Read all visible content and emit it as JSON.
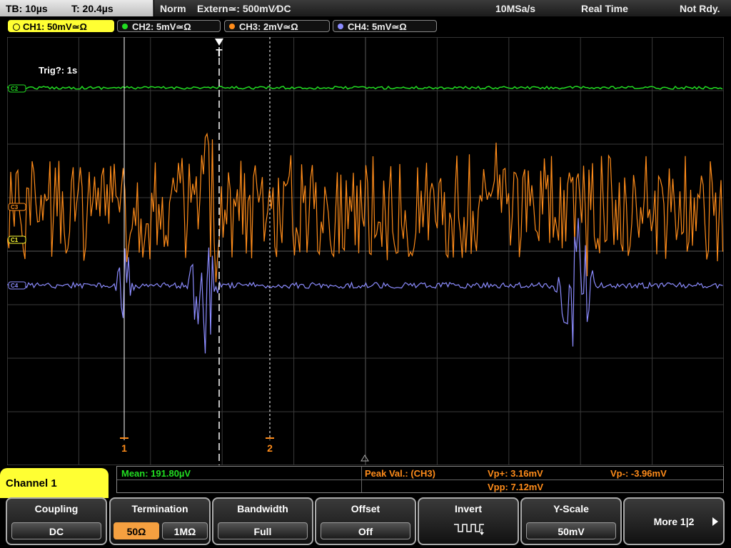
{
  "timebase": {
    "tb": "TB: 10µs",
    "t": "T: 20.4µs"
  },
  "status": {
    "mode": "Norm",
    "trigger": "Extern≃: 500mV∕DC",
    "sample_rate": "10MSa/s",
    "acq": "Real Time",
    "state": "Not Rdy."
  },
  "channels": [
    {
      "label": "CH1: 50mV≃Ω",
      "color": "#ffff33",
      "active": true
    },
    {
      "label": "CH2: 5mV≃Ω",
      "color": "#22dd22",
      "active": false
    },
    {
      "label": "CH3: 2mV≃Ω",
      "color": "#ff8c1a",
      "active": false
    },
    {
      "label": "CH4: 5mV≃Ω",
      "color": "#8c8cff",
      "active": false
    }
  ],
  "trig_label": "Trig?: 1s",
  "trigger_marker": "T",
  "cursors": {
    "c1": "1",
    "c2": "2"
  },
  "markers": {
    "ch2": "C2",
    "ch3": "C3",
    "ch1": "C1",
    "ch4": "C4"
  },
  "colors": {
    "ch1": "#ffff33",
    "ch2": "#22dd22",
    "ch3": "#ff8c1a",
    "ch4": "#8c8cff",
    "meas_green": "#22dd22",
    "meas_orange": "#ff8c1a"
  },
  "measure": {
    "mean": "Mean: 191.80µV",
    "peak_label": "Peak Val.: (CH3)",
    "vp_plus": "Vp+: 3.16mV",
    "vp_minus": "Vp-: -3.96mV",
    "vpp": "Vpp: 7.12mV"
  },
  "channel_title": "Channel 1",
  "softkeys": {
    "coupling": {
      "title": "Coupling",
      "value": "DC"
    },
    "termination": {
      "title": "Termination",
      "opt1": "50Ω",
      "opt2": "1MΩ"
    },
    "bandwidth": {
      "title": "Bandwidth",
      "value": "Full"
    },
    "offset": {
      "title": "Offset",
      "value": "Off"
    },
    "invert": {
      "title": "Invert",
      "icon": "invert-waveform-icon"
    },
    "yscale": {
      "title": "Y-Scale",
      "value": "50mV"
    },
    "more": {
      "title": "More 1|2"
    }
  }
}
